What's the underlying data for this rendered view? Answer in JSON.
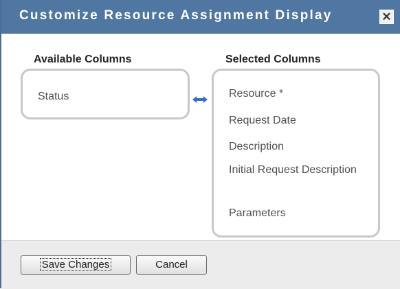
{
  "dialog": {
    "title": "Customize Resource Assignment Display",
    "close_glyph": "✕"
  },
  "available": {
    "heading": "Available Columns",
    "items": [
      "Status"
    ]
  },
  "selected": {
    "heading": "Selected Columns",
    "items": [
      "Resource *",
      "Request Date",
      "Description",
      "Initial Request Description",
      "Parameters"
    ]
  },
  "icons": {
    "swap": "double-arrow-icon"
  },
  "buttons": {
    "save": "Save Changes",
    "cancel": "Cancel"
  },
  "colors": {
    "titlebar": "#4f77a1",
    "swap_arrow": "#3a6fc8"
  }
}
